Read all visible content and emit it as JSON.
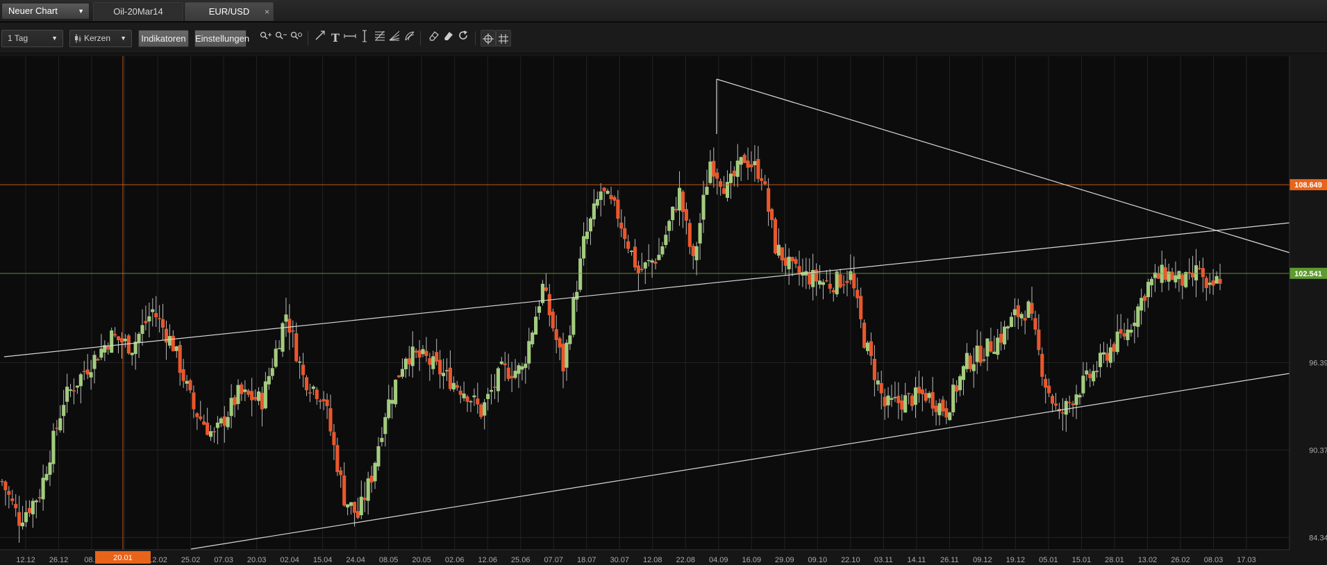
{
  "tabbar": {
    "new_chart_label": "Neuer Chart",
    "tabs": [
      {
        "label": "Oil-20Mar14",
        "active": true
      },
      {
        "label": "EUR/USD",
        "active": false,
        "close": "×"
      }
    ]
  },
  "toolbar": {
    "timeframe": "1 Tag",
    "chart_type": "Kerzen",
    "indicators_label": "Indikatoren",
    "settings_label": "Einstellungen",
    "tools": [
      "zoom-in-icon",
      "zoom-out-icon",
      "zoom-reset-icon",
      "trend-line-icon",
      "text-tool-icon",
      "horizontal-line-icon",
      "vertical-line-icon",
      "fibonacci-retracement-icon",
      "fibonacci-fan-icon",
      "fibonacci-arc-icon",
      "eraser-icon",
      "erase-all-icon",
      "refresh-icon",
      "crosshair-icon",
      "grid-icon"
    ]
  },
  "chart": {
    "colors": {
      "up": "#a3cc7e",
      "down": "#e8572c",
      "wick": "#bdbdbd",
      "crosshair": "#e8641a",
      "green_line": "#6fa33a",
      "trend": "#d9d9d9",
      "grid": "#232323"
    },
    "price_labels": [
      "84.340",
      "90.370",
      "96.390"
    ],
    "price_levels": [
      84.34,
      90.37,
      96.39
    ],
    "highlight_labels": [
      {
        "text": "108.649",
        "value": 108.649,
        "color": "#e8641a"
      },
      {
        "text": "102.541",
        "value": 102.541,
        "color": "#5f9a32"
      }
    ],
    "date_labels": [
      "12.12",
      "26.12",
      "08.0",
      "01",
      "12.02",
      "25.02",
      "07.03",
      "20.03",
      "02.04",
      "15.04",
      "24.04",
      "08.05",
      "20.05",
      "02.06",
      "12.06",
      "25.06",
      "07.07",
      "18.07",
      "30.07",
      "12.08",
      "22.08",
      "04.09",
      "16.09",
      "29.09",
      "09.10",
      "22.10",
      "03.11",
      "14.11",
      "26.11",
      "09.12",
      "19.12",
      "05.01",
      "15.01",
      "28.01",
      "13.02",
      "26.02",
      "08.03",
      "17.03"
    ],
    "crosshair_date": "20.01"
  },
  "chart_data": {
    "type": "candlestick",
    "ylabel": "",
    "xlabel": "",
    "ylim": [
      83.5,
      117.5
    ],
    "x": [
      "12.12",
      "26.12",
      "08.0",
      "01",
      "12.02",
      "25.02",
      "07.03",
      "20.03",
      "02.04",
      "15.04",
      "24.04",
      "08.05",
      "20.05",
      "02.06",
      "12.06",
      "25.06",
      "07.07",
      "18.07",
      "30.07",
      "12.08",
      "22.08",
      "04.09",
      "16.09",
      "29.09",
      "09.10",
      "22.10",
      "03.11",
      "14.11",
      "26.11",
      "09.12",
      "19.12",
      "05.01",
      "15.01",
      "28.01",
      "13.02",
      "26.02",
      "08.03",
      "17.03"
    ],
    "close_path": [
      [
        0,
        88.2
      ],
      [
        5,
        85.6
      ],
      [
        11,
        87.4
      ],
      [
        18,
        93.8
      ],
      [
        24,
        95.8
      ],
      [
        32,
        98.2
      ],
      [
        38,
        97.5
      ],
      [
        44,
        100.0
      ],
      [
        50,
        97.6
      ],
      [
        56,
        93.2
      ],
      [
        62,
        91.3
      ],
      [
        69,
        94.2
      ],
      [
        76,
        93.8
      ],
      [
        83,
        99.8
      ],
      [
        88,
        95.4
      ],
      [
        94,
        94.0
      ],
      [
        100,
        87.1
      ],
      [
        104,
        85.8
      ],
      [
        108,
        88.6
      ],
      [
        112,
        93.0
      ],
      [
        118,
        97.0
      ],
      [
        124,
        96.6
      ],
      [
        130,
        95.4
      ],
      [
        136,
        94.3
      ],
      [
        140,
        93.0
      ],
      [
        146,
        95.8
      ],
      [
        152,
        95.9
      ],
      [
        158,
        101.6
      ],
      [
        164,
        96.1
      ],
      [
        170,
        104.6
      ],
      [
        175,
        108.2
      ],
      [
        180,
        106.6
      ],
      [
        186,
        102.6
      ],
      [
        192,
        103.8
      ],
      [
        198,
        108.1
      ],
      [
        202,
        103.2
      ],
      [
        207,
        110.3
      ],
      [
        212,
        108.3
      ],
      [
        217,
        110.5
      ],
      [
        222,
        109.4
      ],
      [
        226,
        104.4
      ],
      [
        231,
        102.7
      ],
      [
        237,
        102.2
      ],
      [
        242,
        101.8
      ],
      [
        248,
        102.4
      ],
      [
        252,
        98.0
      ],
      [
        258,
        93.4
      ],
      [
        264,
        93.8
      ],
      [
        270,
        94.2
      ],
      [
        276,
        93.1
      ],
      [
        282,
        96.4
      ],
      [
        287,
        97.2
      ],
      [
        292,
        98.2
      ],
      [
        296,
        99.6
      ],
      [
        300,
        100.1
      ],
      [
        305,
        95.0
      ],
      [
        309,
        92.6
      ],
      [
        314,
        94.4
      ],
      [
        319,
        95.7
      ],
      [
        324,
        97.4
      ],
      [
        329,
        98.6
      ],
      [
        335,
        101.8
      ],
      [
        340,
        102.6
      ],
      [
        344,
        102.1
      ],
      [
        347,
        101.9
      ],
      [
        350,
        103.0
      ],
      [
        352,
        101.0
      ],
      [
        356,
        102.3
      ]
    ]
  }
}
